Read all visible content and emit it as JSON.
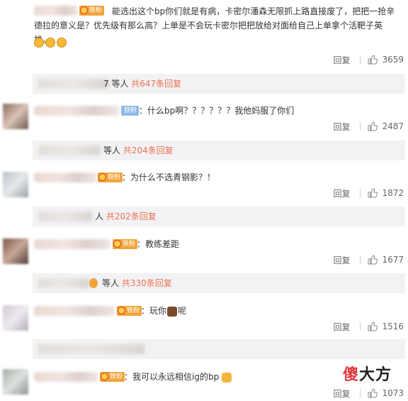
{
  "comments": [
    {
      "badge": "铁粉",
      "text": "能选出这个bp你们就是有病，卡密尔潘森无限抓上路直接废了，把把一抢辛德拉的意义是？优先级有那么高？上单是不会玩卡密尔把把放给对面给自己上单拿个活靶子英雄。",
      "emojis": [
        "clap-icon",
        "clap-icon",
        "clap-icon"
      ],
      "reply_label": "回复",
      "likes": "3659",
      "replies_prefix": "7 等人",
      "replies_link": "共647条回复"
    },
    {
      "badge": "铁粉",
      "text": "：什么bp啊？？？？？？我他妈服了你们",
      "reply_label": "回复",
      "likes": "2487",
      "replies_prefix": "等人",
      "replies_link": "共204条回复"
    },
    {
      "badge": "铁粉",
      "text": "：为什么不选青钢影？！",
      "reply_label": "回复",
      "likes": "1872",
      "replies_prefix": "人",
      "replies_link": "共202条回复"
    },
    {
      "badge": "铁粉",
      "text": "：教练差距",
      "reply_label": "回复",
      "likes": "1677",
      "replies_prefix": "等人",
      "replies_link": "共330条回复"
    },
    {
      "badge": "铁粉",
      "text_before": "：玩你",
      "text_after": "呢",
      "reply_label": "回复",
      "likes": "1516"
    },
    {
      "badge": "铁粉",
      "text": "：我可以永远相信ig的bp",
      "reply_label": "回复",
      "likes": "1073"
    }
  ],
  "watermark": {
    "part1": "傻",
    "part2": "大方"
  },
  "colors": {
    "link": "#eb7350",
    "badge_gold": "#f0a43a",
    "badge_blue": "#8fb8e8"
  }
}
